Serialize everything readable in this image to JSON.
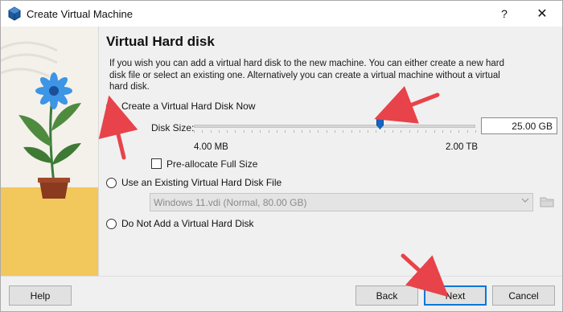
{
  "window": {
    "title": "Create Virtual Machine",
    "help_label": "?",
    "close_label": "✕"
  },
  "page": {
    "heading": "Virtual Hard disk",
    "description": "If you wish you can add a virtual hard disk to the new machine. You can either create a new hard disk file or select an existing one. Alternatively you can create a virtual machine without a virtual hard disk."
  },
  "options": {
    "create_now": {
      "label": "Create a Virtual Hard Disk Now",
      "selected": true
    },
    "use_existing": {
      "label": "Use an Existing Virtual Hard Disk File",
      "selected": false
    },
    "no_disk": {
      "label": "Do Not Add a Virtual Hard Disk",
      "selected": false
    }
  },
  "disk_size": {
    "label": "Disk Size:",
    "value": "25.00 GB",
    "min_label": "4.00 MB",
    "max_label": "2.00 TB",
    "slider_level": 0.66
  },
  "preallocate": {
    "label": "Pre-allocate Full Size",
    "checked": false
  },
  "existing_file": {
    "selected": "Windows 11.vdi (Normal, 80.00 GB)",
    "enabled": false
  },
  "buttons": {
    "help": "Help",
    "back": "Back",
    "next": "Next",
    "cancel": "Cancel"
  },
  "colors": {
    "accent": "#1565c0",
    "annotation_arrow": "#e8434a",
    "illustration_sky": "#f4f1ea",
    "illustration_ground": "#f2c75c"
  },
  "icons": [
    "virtualbox-icon",
    "help-icon",
    "close-icon",
    "folder-icon",
    "chevron-down-icon"
  ]
}
